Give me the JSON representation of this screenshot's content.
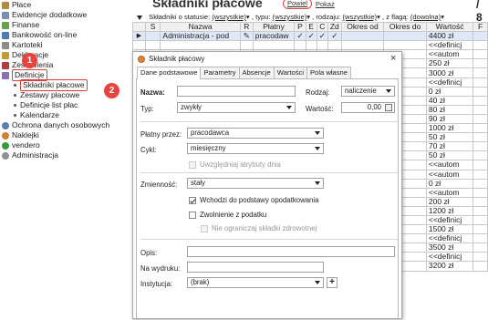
{
  "tree": {
    "items": [
      {
        "label": "Płace",
        "color": "#b38b3c"
      },
      {
        "label": "Ewidencje dodatkowe",
        "color": "#7a8fb0"
      },
      {
        "label": "Finanse",
        "color": "#6b9e4d"
      },
      {
        "label": "Bankowość on-line",
        "color": "#4d7db3"
      },
      {
        "label": "Kartoteki",
        "color": "#8c8c8c"
      },
      {
        "label": "Deklaracje",
        "color": "#c49a3a"
      },
      {
        "label": "Zestawienia",
        "color": "#b04040"
      },
      {
        "label": "Definicje",
        "color": "#8a6fb3"
      }
    ],
    "sub_items": [
      "Składniki płacowe",
      "Zestawy płacowe",
      "Definicje list płac",
      "Kalendarze"
    ],
    "items2": [
      {
        "label": "Ochrona danych osobowych",
        "color": "#5a7fb0"
      },
      {
        "label": "Naklejki",
        "color": "#d08030"
      },
      {
        "label": "vendero",
        "color": "#3a9a3a"
      },
      {
        "label": "Administracja",
        "color": "#909090"
      }
    ],
    "badge1": "1",
    "badge2": "2"
  },
  "header": {
    "title": "Składniki płacowe",
    "btn_powiel": "Powiel",
    "btn_pokaz": "Pokaż",
    "page_count": "/ 8"
  },
  "filter": {
    "status_label": "Składniki o statusie:",
    "status_value": "(wszystkie)",
    "typ_label": ", typu:",
    "typ_value": "(wszystkie)",
    "rodzaj_label": ", rodzaju:",
    "rodzaj_value": "(wszystkie)",
    "flaga_label": ", z flagą:",
    "flaga_value": "(dowolna)"
  },
  "grid": {
    "columns": [
      "S",
      "Nazwa",
      "R",
      "Płatny",
      "P",
      "E",
      "C",
      "Zd",
      "Okres od",
      "Okres do",
      "Wartość",
      "F"
    ],
    "first_row": {
      "nazwa": "Administracja - pod",
      "r": "✎",
      "platny": "pracodaw",
      "p": "✓",
      "e": "✓",
      "c": "✓",
      "zd": "✓",
      "wartosc": "4400 zł"
    },
    "values": [
      "<<definicj",
      "<<autom",
      "250 zł",
      "3000 zł",
      "<<definicj",
      "0 zł",
      "40 zł",
      "80 zł",
      "90 zł",
      "1000 zł",
      "50 zł",
      "70 zł",
      "50 zł",
      "<<autom",
      "<<autom",
      "0 zł",
      "<<autom",
      "200 zł",
      "1200 zł",
      "<<definicj",
      "1500 zł",
      "<<definicj",
      "3500 zł",
      "<<definicj",
      "3200 zł"
    ]
  },
  "dialog": {
    "title": "Składnik płacowy",
    "tabs": [
      "Dane podstawowe",
      "Parametry",
      "Absencje",
      "Wartości",
      "Pola własne"
    ],
    "nazwa_label": "Nazwa:",
    "nazwa_value": "",
    "rodzaj_label": "Rodzaj:",
    "rodzaj_value": "naliczenie",
    "typ_label": "Typ:",
    "typ_value": "zwykły",
    "wartosc_label": "Wartość:",
    "wartosc_value": "0,00",
    "platny_label": "Płatny przez:",
    "platny_value": "pracodawca",
    "cykl_label": "Cykl:",
    "cykl_value": "miesięczny",
    "uwzgl_label": "Uwzględniaj atrybuty dnia",
    "zmiennosc_label": "Zmienność:",
    "zmiennosc_value": "stały",
    "wchodzi_label": "Wchodzi do podstawy opodatkowania",
    "zwolnienie_label": "Zwolnienie z podatku",
    "nieogr_label": "Nie ograniczaj składki zdrowotnej",
    "opis_label": "Opis:",
    "wydruk_label": "Na wydruku:",
    "instytucja_label": "Instytucja:",
    "instytucja_value": "(brak)"
  }
}
